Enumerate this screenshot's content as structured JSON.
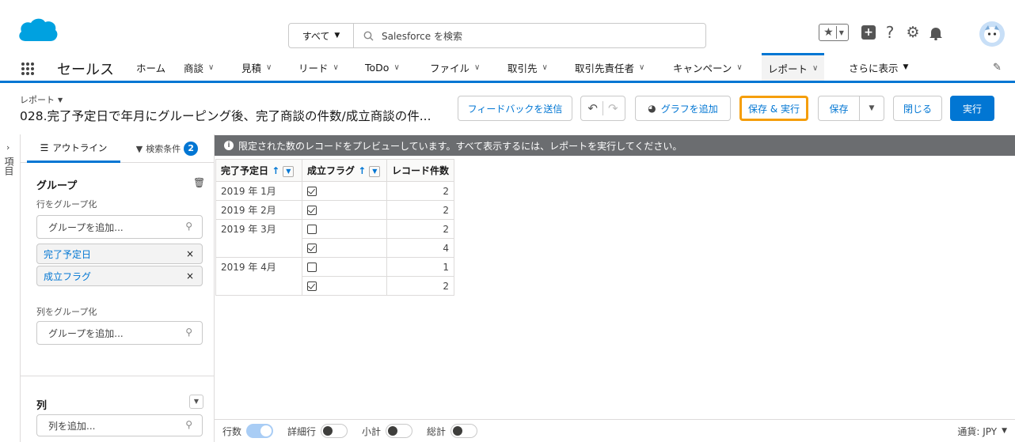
{
  "header": {
    "search_scope": "すべて",
    "search_placeholder": "Salesforce を検索"
  },
  "nav": {
    "app_name": "セールス",
    "items": [
      {
        "label": "ホーム",
        "chevron": false
      },
      {
        "label": "商談",
        "chevron": true
      },
      {
        "label": "見積",
        "chevron": true
      },
      {
        "label": "リード",
        "chevron": true
      },
      {
        "label": "ToDo",
        "chevron": true
      },
      {
        "label": "ファイル",
        "chevron": true
      },
      {
        "label": "取引先",
        "chevron": true
      },
      {
        "label": "取引先責任者",
        "chevron": true
      },
      {
        "label": "キャンペーン",
        "chevron": true
      },
      {
        "label": "レポート",
        "chevron": true,
        "active": true
      }
    ],
    "more": "さらに表示"
  },
  "report": {
    "object_label": "レポート",
    "title": "028.完了予定日で年月にグルーピング後、完了商談の件数/成立商談の件...",
    "buttons": {
      "feedback": "フィードバックを送信",
      "add_chart": "グラフを追加",
      "save_run": "保存 & 実行",
      "save": "保存",
      "close": "閉じる",
      "run": "実行"
    }
  },
  "rail": {
    "label": "項目"
  },
  "panel": {
    "tab_outline": "アウトライン",
    "tab_filters": "検索条件",
    "filter_count": "2",
    "groups_title": "グループ",
    "row_group_label": "行をグループ化",
    "add_group_placeholder": "グループを追加...",
    "row_groups": [
      "完了予定日",
      "成立フラグ"
    ],
    "col_group_label": "列をグループ化",
    "col_add_placeholder": "グループを追加...",
    "columns_title": "列",
    "add_column_placeholder": "列を追加..."
  },
  "preview": {
    "banner": "限定された数のレコードをプレビューしています。すべて表示するには、レポートを実行してください。",
    "headers": [
      "完了予定日",
      "成立フラグ",
      "レコード件数"
    ],
    "rows": [
      {
        "date": "2019 年 1月",
        "flag": true,
        "count": "2"
      },
      {
        "date": "2019 年 2月",
        "flag": true,
        "count": "2"
      },
      {
        "date": "2019 年 3月",
        "flag": false,
        "count": "2"
      },
      {
        "date": "",
        "flag": true,
        "count": "4"
      },
      {
        "date": "2019 年 4月",
        "flag": false,
        "count": "1"
      },
      {
        "date": "",
        "flag": true,
        "count": "2"
      }
    ]
  },
  "footer": {
    "row_count": "行数",
    "detail_rows": "詳細行",
    "subtotal": "小計",
    "grand_total": "総計",
    "currency": "通貨: JPY"
  },
  "colors": {
    "brand": "#0176d3",
    "highlight_border": "#f59e0b",
    "banner": "#6b6d70"
  }
}
